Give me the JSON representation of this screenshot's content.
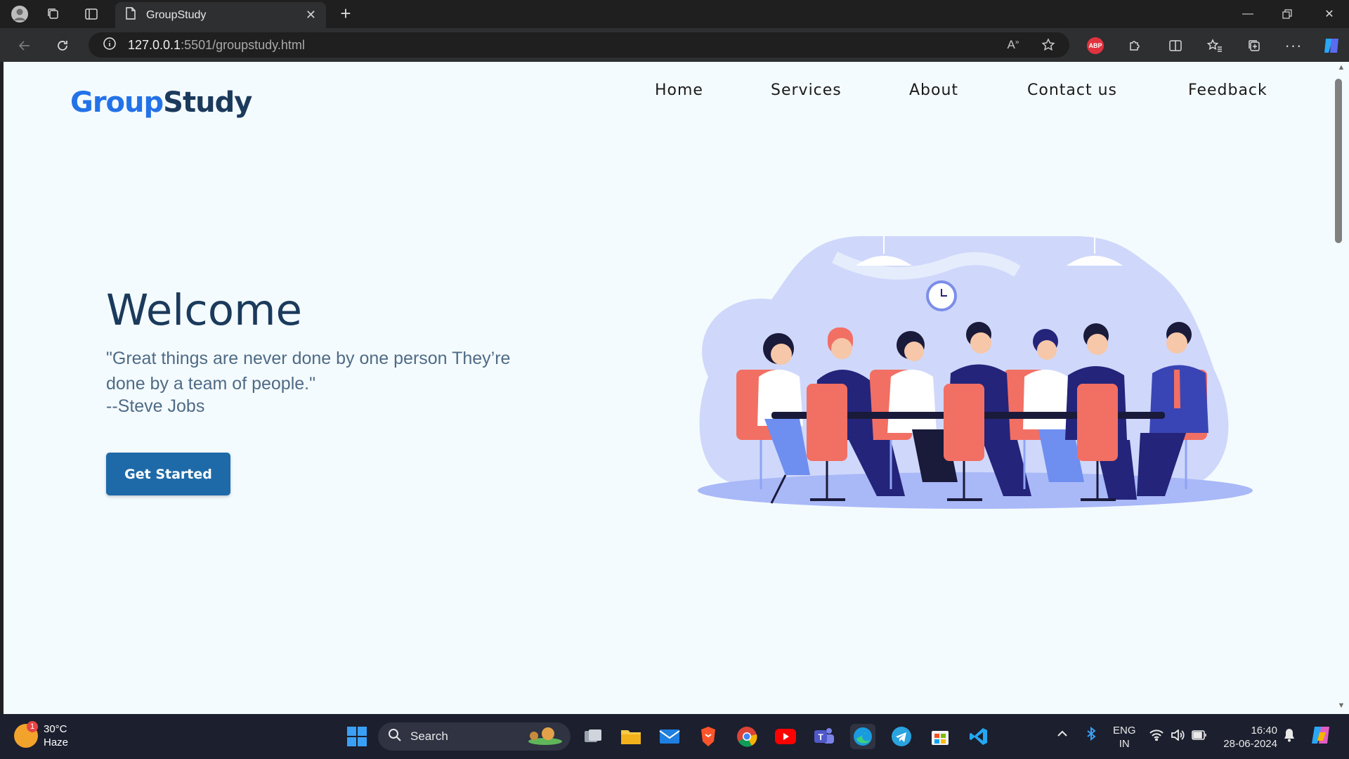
{
  "browser": {
    "tab_title": "GroupStudy",
    "url_host": "127.0.0.1",
    "url_path": ":5501/groupstudy.html",
    "extension_label": "ABP"
  },
  "page": {
    "logo_part1": "Group",
    "logo_part2": "Study",
    "nav": [
      "Home",
      "Services",
      "About",
      "Contact us",
      "Feedback"
    ],
    "hero_title": "Welcome",
    "hero_quote": "\"Great things are never done by one person They’re done by a team of people.\"",
    "hero_author": "--Steve Jobs",
    "cta_label": "Get Started"
  },
  "taskbar": {
    "weather_temp": "30°C",
    "weather_desc": "Haze",
    "weather_badge": "1",
    "search_label": "Search",
    "lang_line1": "ENG",
    "lang_line2": "IN",
    "time": "16:40",
    "date": "28-06-2024"
  },
  "colors": {
    "page_bg": "#f4fbfe",
    "logo_blue": "#2372e8",
    "logo_dark": "#1b3a5c",
    "button_bg": "#1e6aa8",
    "chair_coral": "#f26f63",
    "suit_navy": "#24247a",
    "blob_lavender": "#cfd8fb"
  }
}
